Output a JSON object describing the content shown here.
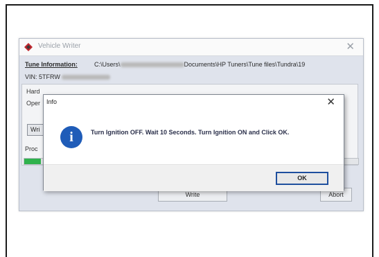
{
  "vehicle_writer": {
    "title": "Vehicle Writer",
    "close_glyph": "✕",
    "tune_info_label": "Tune Information:",
    "tune_path_prefix": "C:\\Users\\",
    "tune_path_suffix": "Documents\\HP Tuners\\Tune files\\Tundra\\19",
    "vin_label": "VIN: 5TFRW",
    "hardware_label": "Hard",
    "operation_label": "Oper",
    "write_btn_label": "Wri",
    "process_label": "Proc",
    "progress_fraction": 0.05,
    "write_button_label": "Write",
    "abort_button_label": "Abort",
    "logo_icon": "hp-tuners-logo-icon"
  },
  "info_dialog": {
    "title": "Info",
    "close_glyph": "✕",
    "icon": "info-icon",
    "icon_glyph": "i",
    "message": "Turn Ignition OFF. Wait 10 Seconds. Turn Ignition ON and Click OK.",
    "ok_label": "OK"
  },
  "colors": {
    "info_icon": "#1f5cb8",
    "progress": "#2fb24d",
    "ok_border": "#1e4f9e"
  }
}
